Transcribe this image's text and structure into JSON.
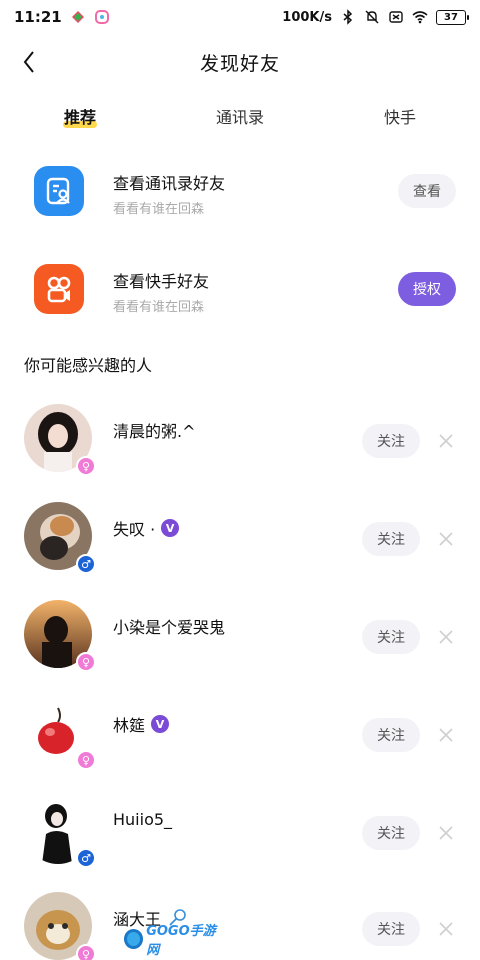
{
  "status_bar": {
    "time": "11:21",
    "speed": "100K/s",
    "battery": "37"
  },
  "header": {
    "title": "发现好友"
  },
  "tabs": [
    {
      "label": "推荐",
      "active": true
    },
    {
      "label": "通讯录",
      "active": false
    },
    {
      "label": "快手",
      "active": false
    }
  ],
  "find_friends": [
    {
      "title": "查看通讯录好友",
      "subtitle": "看看有谁在回森",
      "button": "查看",
      "icon": "contacts-icon"
    },
    {
      "title": "查看快手好友",
      "subtitle": "看看有谁在回森",
      "button": "授权",
      "icon": "kuaishou-icon"
    }
  ],
  "section_title": "你可能感兴趣的人",
  "suggestions": [
    {
      "name": "清晨的粥.^",
      "gender": "female",
      "verified": false,
      "button": "关注"
    },
    {
      "name": "失叹 ·",
      "gender": "male",
      "verified": true,
      "button": "关注"
    },
    {
      "name": "小染是个爱哭鬼",
      "gender": "female",
      "verified": false,
      "button": "关注"
    },
    {
      "name": "林筵",
      "gender": "female",
      "verified": true,
      "button": "关注"
    },
    {
      "name": "Huiio5_",
      "gender": "male",
      "verified": false,
      "button": "关注"
    },
    {
      "name": "涵大王",
      "gender": "female",
      "verified": false,
      "button": "关注"
    }
  ],
  "watermark": {
    "text": "GOGO手游网"
  },
  "colors": {
    "accent_purple": "#7e5ee0",
    "tab_highlight": "#ffd84d",
    "female": "#f07bd6",
    "male": "#1c63d8",
    "verified": "#7b4bd6"
  }
}
